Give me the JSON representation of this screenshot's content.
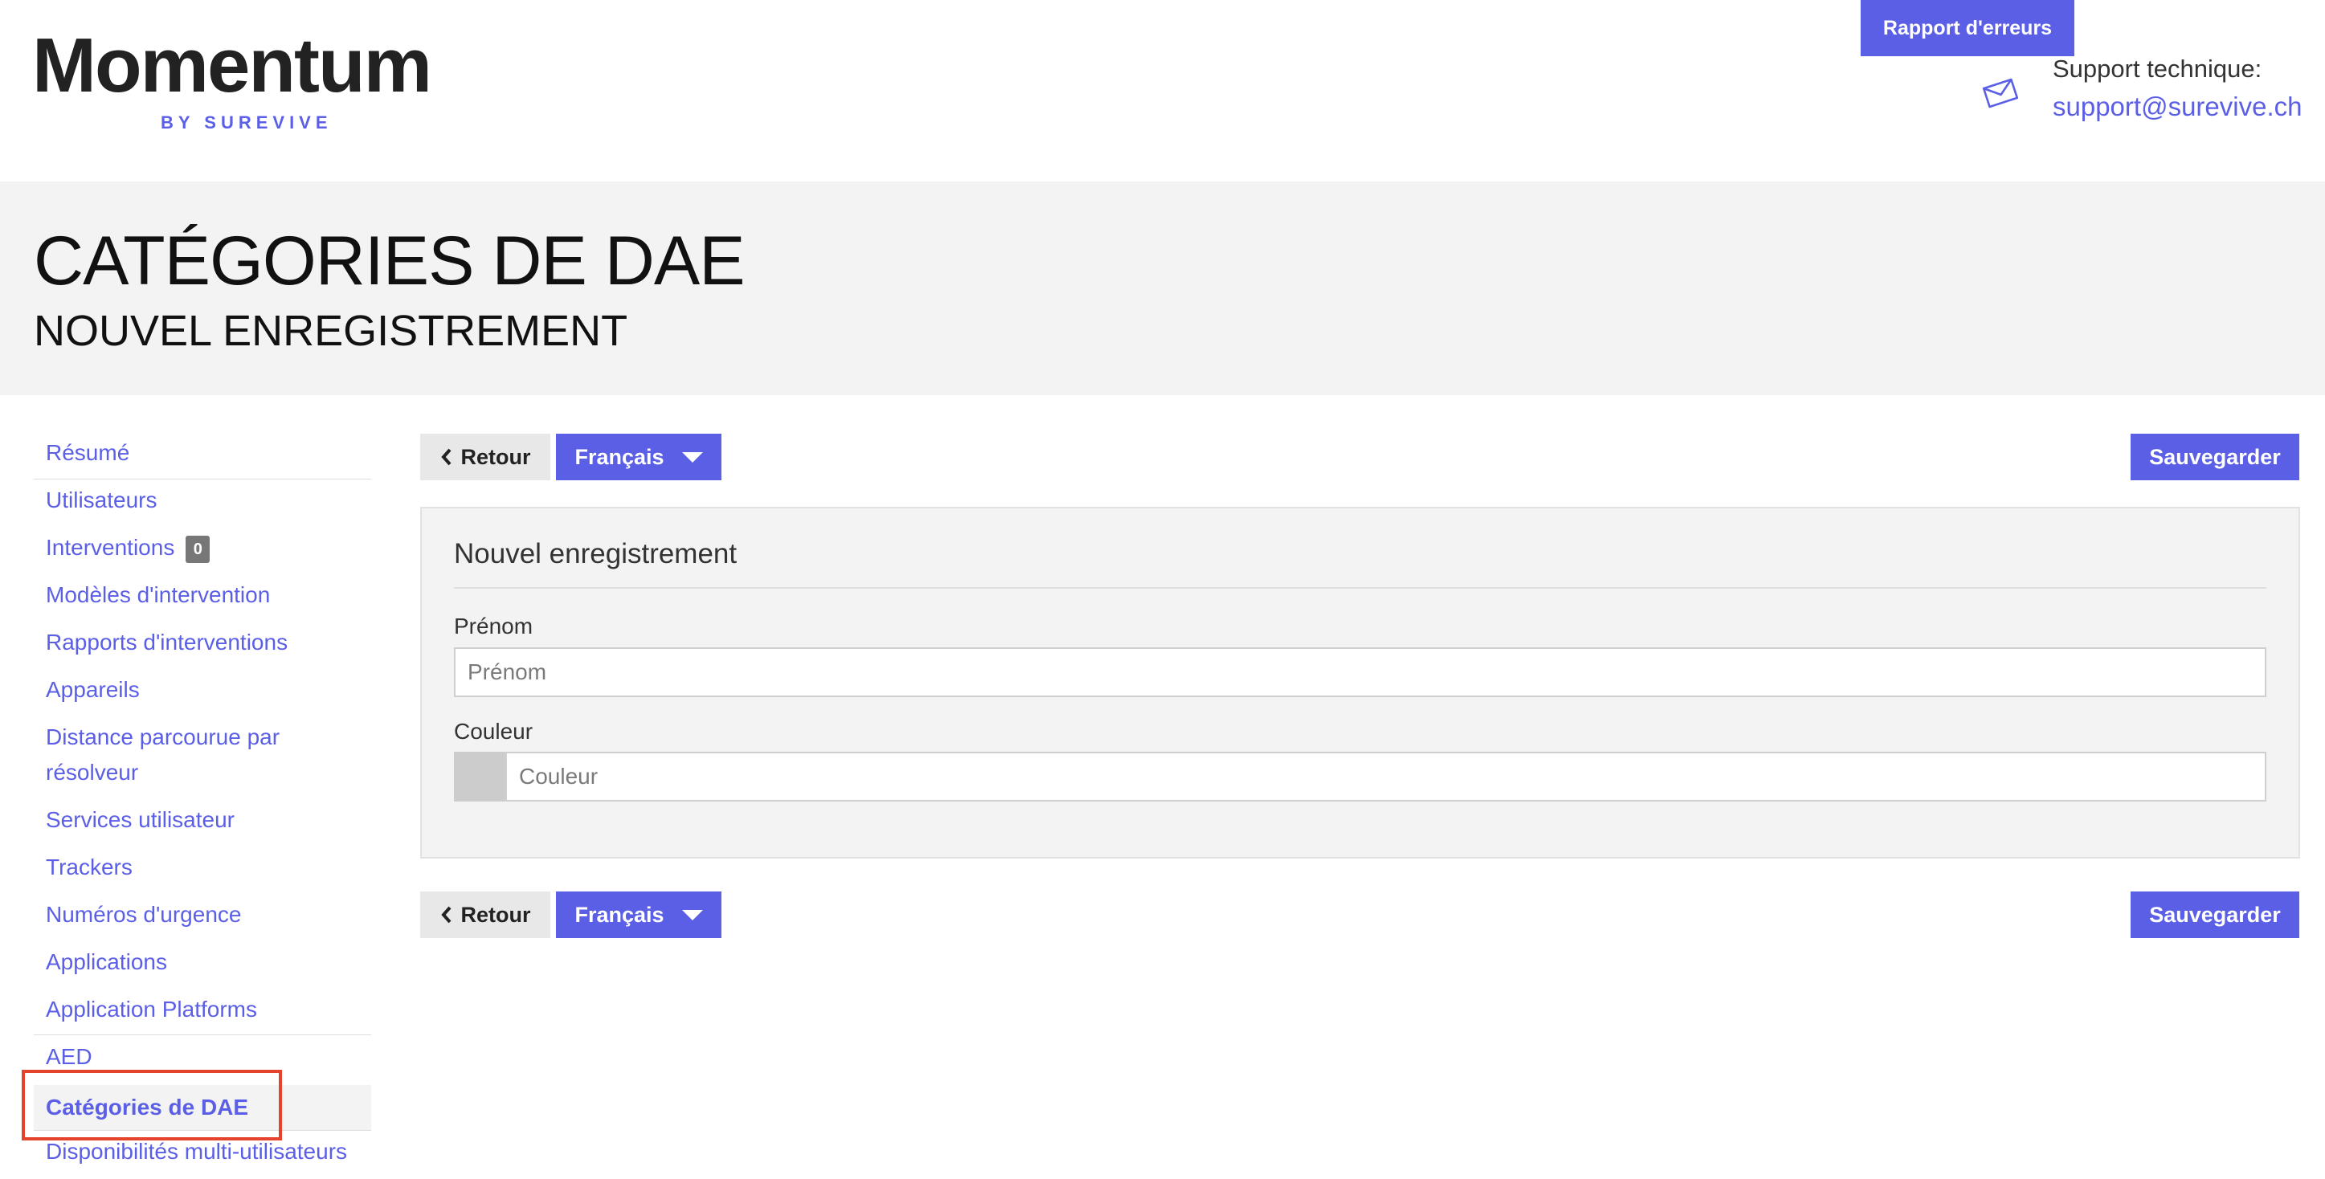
{
  "header": {
    "logo_word": "Momentum",
    "logo_sub": "BY SUREVIVE",
    "report_button": "Rapport d'erreurs",
    "support_label": "Support technique:",
    "support_email": "support@surevive.ch"
  },
  "page": {
    "title": "CATÉGORIES DE DAE",
    "subtitle": "NOUVEL ENREGISTREMENT"
  },
  "sidebar": {
    "items": [
      {
        "label": "Résumé"
      },
      {
        "label": "Utilisateurs"
      },
      {
        "label": "Interventions",
        "badge": "0"
      },
      {
        "label": "Modèles d'intervention"
      },
      {
        "label": "Rapports d'interventions"
      },
      {
        "label": "Appareils"
      },
      {
        "label": "Distance parcourue par résolveur"
      },
      {
        "label": "Services utilisateur"
      },
      {
        "label": "Trackers"
      },
      {
        "label": "Numéros d'urgence"
      },
      {
        "label": "Applications"
      },
      {
        "label": "Application Platforms"
      },
      {
        "label": "AED"
      },
      {
        "label": "Catégories de DAE",
        "active": true
      },
      {
        "label": "Disponibilités multi-utilisateurs"
      }
    ]
  },
  "toolbar": {
    "back_label": "Retour",
    "language_label": "Français",
    "save_label": "Sauvegarder"
  },
  "form": {
    "title": "Nouvel enregistrement",
    "first_name_label": "Prénom",
    "first_name_placeholder": "Prénom",
    "first_name_value": "",
    "color_label": "Couleur",
    "color_placeholder": "Couleur",
    "color_value": ""
  },
  "colors": {
    "accent": "#5b5fe6",
    "highlight": "#e5432b",
    "band": "#f3f3f3"
  }
}
